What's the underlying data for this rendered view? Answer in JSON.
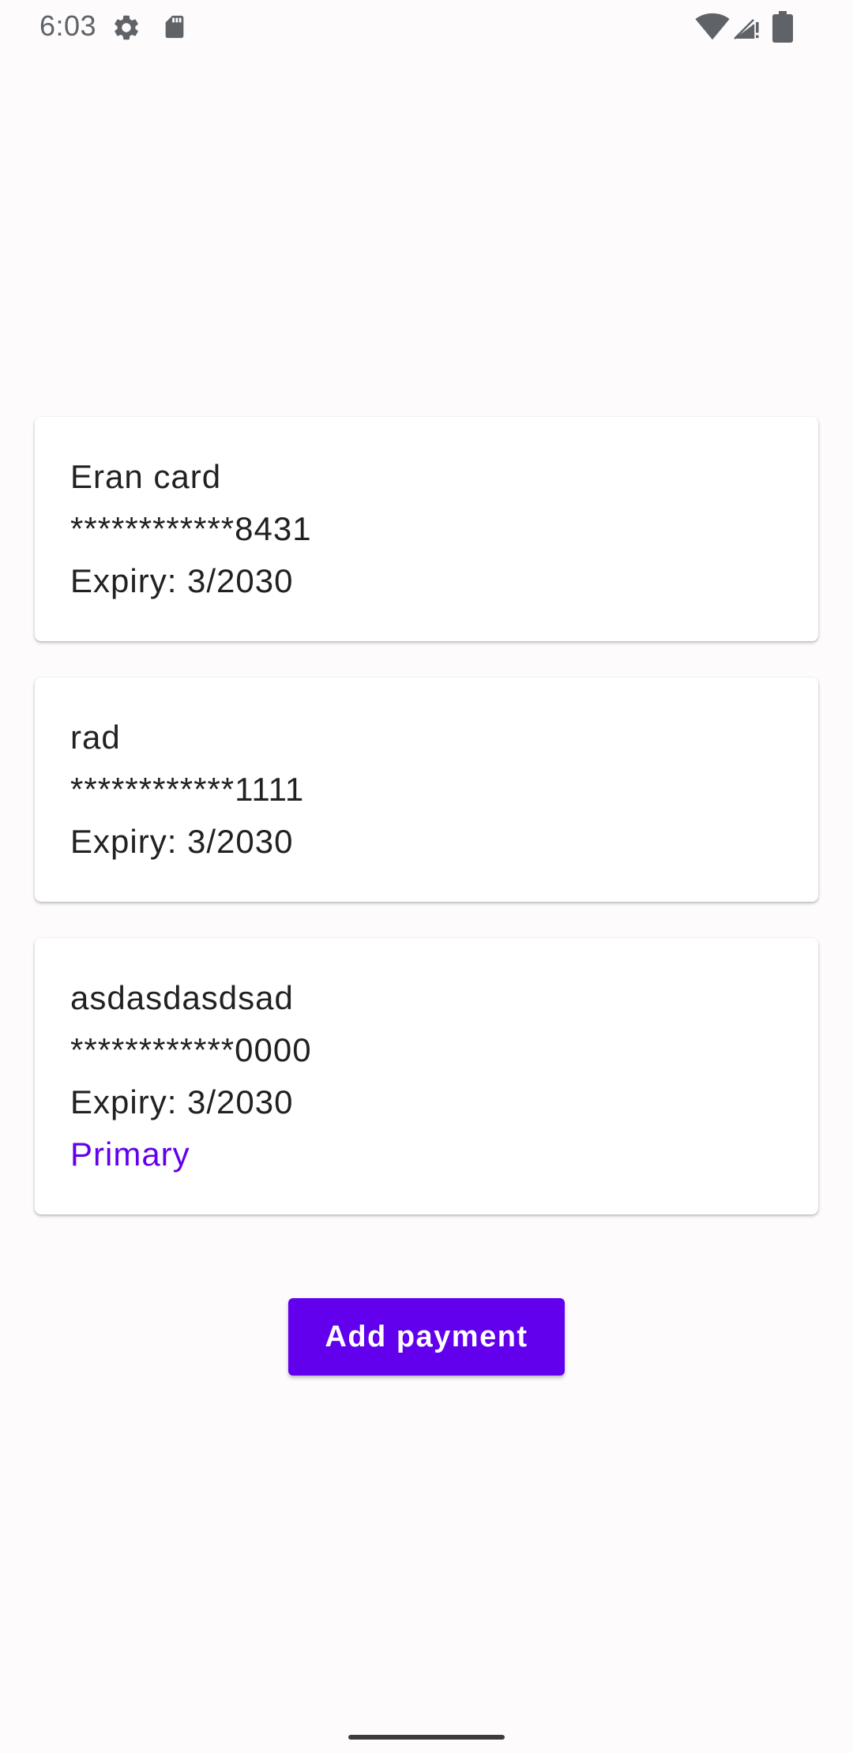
{
  "status_bar": {
    "time": "6:03",
    "icons": [
      "gear-icon",
      "sd-card-icon",
      "wifi-icon",
      "signal-icon",
      "battery-icon"
    ]
  },
  "cards": [
    {
      "name": "Eran card",
      "number": "************8431",
      "expiry": "Expiry: 3/2030"
    },
    {
      "name": "rad",
      "number": "************1111",
      "expiry": "Expiry: 3/2030"
    },
    {
      "name": "asdasdasdsad",
      "number": "************0000",
      "expiry": "Expiry: 3/2030",
      "badge": "Primary"
    }
  ],
  "add_button": {
    "label": "Add payment"
  },
  "colors": {
    "accent": "#6200ee",
    "background": "#fdfbfc",
    "card": "#ffffff",
    "text": "#212121"
  }
}
